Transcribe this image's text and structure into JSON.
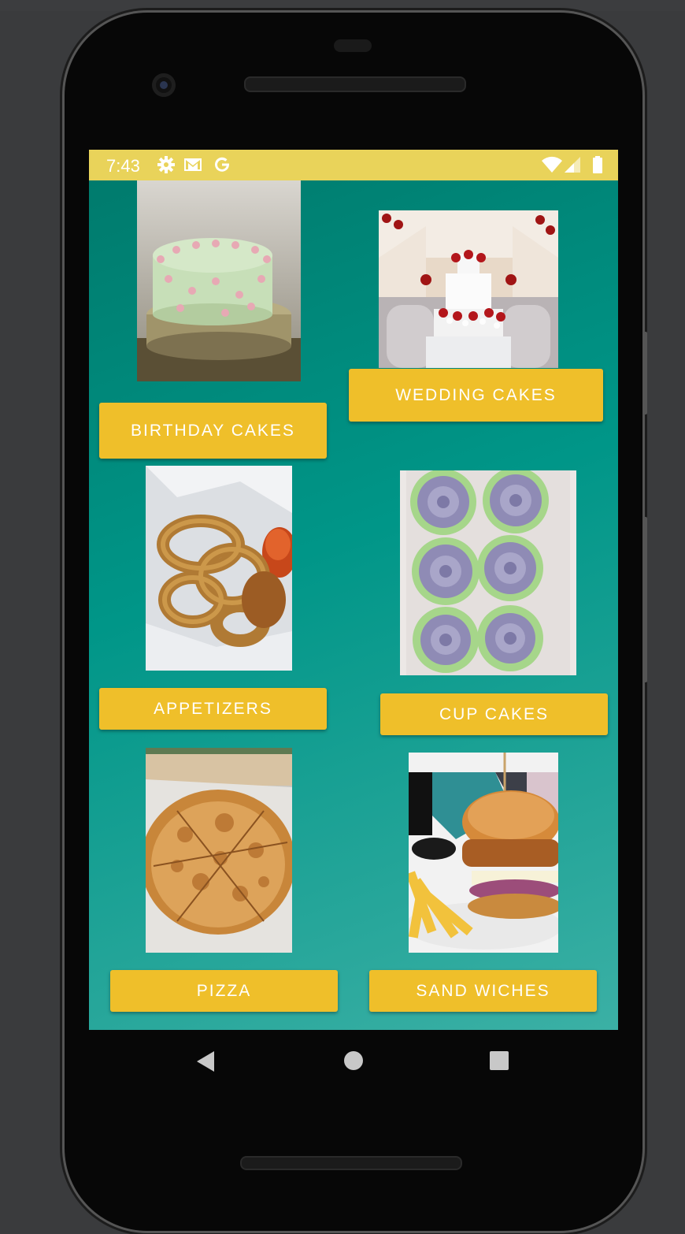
{
  "status_bar": {
    "time": "7:43",
    "icons": [
      "settings-icon",
      "gmail-icon",
      "google-icon",
      "wifi-icon",
      "signal-icon",
      "battery-icon"
    ]
  },
  "categories": [
    {
      "label": "BIRTHDAY CAKES",
      "image": "birthday-cake-photo"
    },
    {
      "label": "WEDDING CAKES",
      "image": "wedding-cake-photo"
    },
    {
      "label": "APPETIZERS",
      "image": "onion-rings-photo"
    },
    {
      "label": "CUP CAKES",
      "image": "cupcakes-photo"
    },
    {
      "label": "PIZZA",
      "image": "pizza-photo"
    },
    {
      "label": "SAND WICHES",
      "image": "burger-photo"
    }
  ],
  "colors": {
    "status_bar": "#e9d35a",
    "background": "#009688",
    "button": "#efbf2a",
    "button_text": "#ffffff"
  },
  "nav": [
    "back-icon",
    "home-icon",
    "recents-icon"
  ]
}
